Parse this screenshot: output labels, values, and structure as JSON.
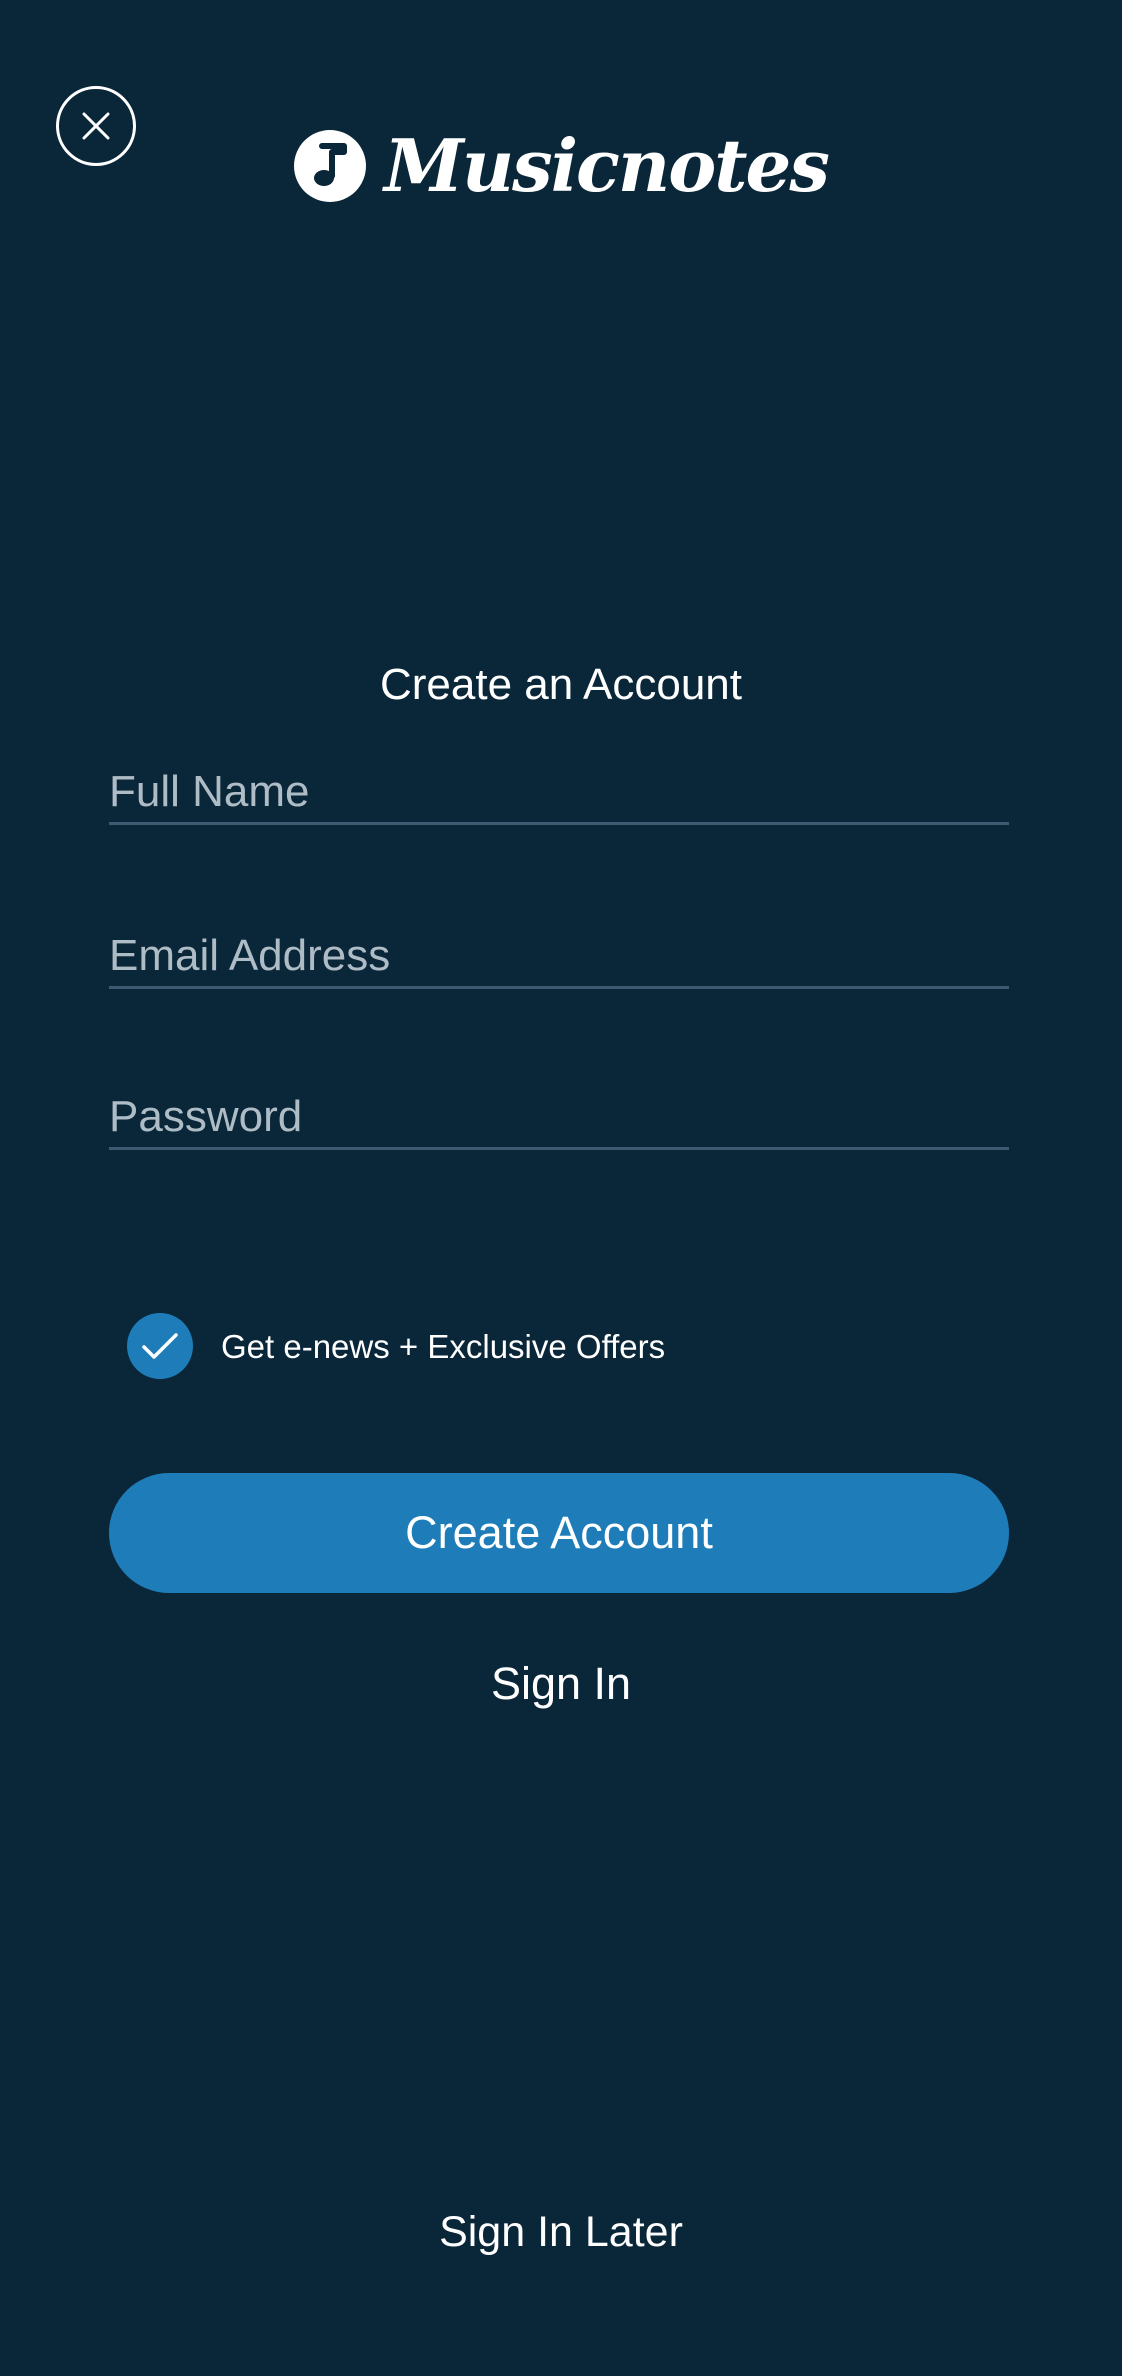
{
  "header": {
    "close_icon": "close-icon",
    "logo_text": "Musicnotes",
    "logo_icon": "music-note-icon"
  },
  "form": {
    "title": "Create an Account",
    "full_name": {
      "placeholder": "Full Name",
      "value": ""
    },
    "email": {
      "placeholder": "Email Address",
      "value": ""
    },
    "password": {
      "placeholder": "Password",
      "value": ""
    },
    "newsletter": {
      "label": "Get e-news + Exclusive Offers",
      "checked": true,
      "icon": "checkmark-icon"
    },
    "create_button_label": "Create Account",
    "sign_in_label": "Sign In",
    "sign_in_later_label": "Sign In Later"
  },
  "colors": {
    "background": "#0a2639",
    "accent": "#1e7db9",
    "placeholder": "#aebcc6",
    "field_underline": "#3c5a70"
  }
}
